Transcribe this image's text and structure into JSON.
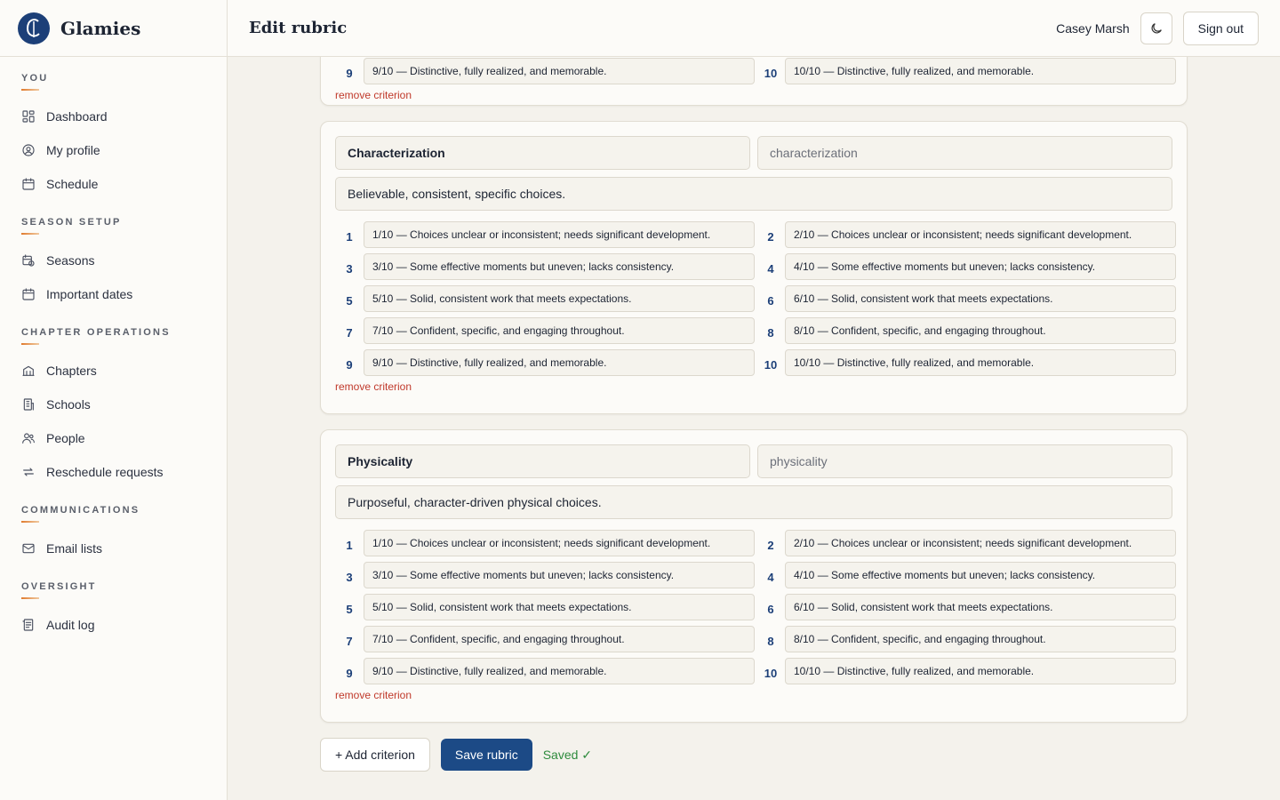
{
  "brand": {
    "name": "Glamies"
  },
  "header": {
    "title": "Edit rubric",
    "user": "Casey Marsh",
    "sign_out": "Sign out"
  },
  "sidebar": {
    "groups": [
      {
        "title": "YOU",
        "items": [
          {
            "label": "Dashboard",
            "icon": "dashboard-icon"
          },
          {
            "label": "My profile",
            "icon": "user-circle-icon"
          },
          {
            "label": "Schedule",
            "icon": "calendar-icon"
          }
        ]
      },
      {
        "title": "SEASON SETUP",
        "items": [
          {
            "label": "Seasons",
            "icon": "calendar-clock-icon"
          },
          {
            "label": "Important dates",
            "icon": "calendar-icon"
          }
        ]
      },
      {
        "title": "CHAPTER OPERATIONS",
        "items": [
          {
            "label": "Chapters",
            "icon": "chapters-icon"
          },
          {
            "label": "Schools",
            "icon": "school-icon"
          },
          {
            "label": "People",
            "icon": "people-icon"
          },
          {
            "label": "Reschedule requests",
            "icon": "repeat-icon"
          }
        ]
      },
      {
        "title": "COMMUNICATIONS",
        "items": [
          {
            "label": "Email lists",
            "icon": "mail-icon"
          }
        ]
      },
      {
        "title": "OVERSIGHT",
        "items": [
          {
            "label": "Audit log",
            "icon": "audit-log-icon"
          }
        ]
      }
    ]
  },
  "criteria": [
    {
      "name": "",
      "key": "",
      "description": "",
      "levels": [
        {
          "num": "9",
          "text": "9/10 — Distinctive, fully realized, and memorable."
        },
        {
          "num": "10",
          "text": "10/10 — Distinctive, fully realized, and memorable."
        }
      ],
      "remove_label": "remove criterion"
    },
    {
      "name": "Characterization",
      "key": "characterization",
      "description": "Believable, consistent, specific choices.",
      "levels": [
        {
          "num": "1",
          "text": "1/10 — Choices unclear or inconsistent; needs significant development."
        },
        {
          "num": "2",
          "text": "2/10 — Choices unclear or inconsistent; needs significant development."
        },
        {
          "num": "3",
          "text": "3/10 — Some effective moments but uneven; lacks consistency."
        },
        {
          "num": "4",
          "text": "4/10 — Some effective moments but uneven; lacks consistency."
        },
        {
          "num": "5",
          "text": "5/10 — Solid, consistent work that meets expectations."
        },
        {
          "num": "6",
          "text": "6/10 — Solid, consistent work that meets expectations."
        },
        {
          "num": "7",
          "text": "7/10 — Confident, specific, and engaging throughout."
        },
        {
          "num": "8",
          "text": "8/10 — Confident, specific, and engaging throughout."
        },
        {
          "num": "9",
          "text": "9/10 — Distinctive, fully realized, and memorable."
        },
        {
          "num": "10",
          "text": "10/10 — Distinctive, fully realized, and memorable."
        }
      ],
      "remove_label": "remove criterion"
    },
    {
      "name": "Physicality",
      "key": "physicality",
      "description": "Purposeful, character-driven physical choices.",
      "levels": [
        {
          "num": "1",
          "text": "1/10 — Choices unclear or inconsistent; needs significant development."
        },
        {
          "num": "2",
          "text": "2/10 — Choices unclear or inconsistent; needs significant development."
        },
        {
          "num": "3",
          "text": "3/10 — Some effective moments but uneven; lacks consistency."
        },
        {
          "num": "4",
          "text": "4/10 — Some effective moments but uneven; lacks consistency."
        },
        {
          "num": "5",
          "text": "5/10 — Solid, consistent work that meets expectations."
        },
        {
          "num": "6",
          "text": "6/10 — Solid, consistent work that meets expectations."
        },
        {
          "num": "7",
          "text": "7/10 — Confident, specific, and engaging throughout."
        },
        {
          "num": "8",
          "text": "8/10 — Confident, specific, and engaging throughout."
        },
        {
          "num": "9",
          "text": "9/10 — Distinctive, fully realized, and memorable."
        },
        {
          "num": "10",
          "text": "10/10 — Distinctive, fully realized, and memorable."
        }
      ],
      "remove_label": "remove criterion"
    }
  ],
  "actions": {
    "add": "+ Add criterion",
    "save": "Save rubric",
    "status": "Saved ✓"
  },
  "colors": {
    "primary": "#1c4a86",
    "accent": "#e07b2e",
    "danger": "#c0392b",
    "success": "#2e8b3d"
  }
}
